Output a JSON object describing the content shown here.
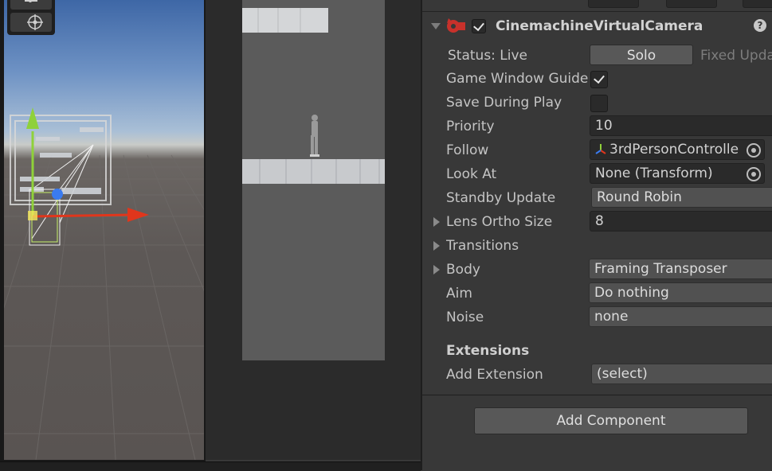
{
  "inspector": {
    "component": {
      "title": "CinemachineVirtualCamera",
      "enabled": true,
      "help_icon": "?"
    },
    "status": {
      "label": "Status: Live",
      "solo_button": "Solo",
      "update_text": "Fixed Upda"
    },
    "rows": {
      "game_window_guides": {
        "label": "Game Window Guide",
        "checked": true
      },
      "save_during_play": {
        "label": "Save During Play",
        "checked": false
      },
      "priority": {
        "label": "Priority",
        "value": "10"
      },
      "follow": {
        "label": "Follow",
        "value": "3rdPersonControlle"
      },
      "look_at": {
        "label": "Look At",
        "value": "None (Transform)"
      },
      "standby_update": {
        "label": "Standby Update",
        "value": "Round Robin"
      },
      "lens_ortho_size": {
        "label": "Lens Ortho Size",
        "value": "8"
      },
      "transitions": {
        "label": "Transitions"
      },
      "body": {
        "label": "Body",
        "value": "Framing Transposer"
      },
      "aim": {
        "label": "Aim",
        "value": "Do nothing"
      },
      "noise": {
        "label": "Noise",
        "value": "none"
      }
    },
    "extensions": {
      "heading": "Extensions",
      "add_label": "Add Extension",
      "add_value": "(select)"
    },
    "add_component_button": "Add Component"
  },
  "icons": {
    "component_icon": "cinemachine-camera-icon",
    "follow_target_icon": "transform-icon",
    "object_picker": "object-picker-icon"
  },
  "colors": {
    "panel_bg": "#383838",
    "field_bg": "#2a2a2a",
    "dropdown_bg": "#515151",
    "axis_x": "#e0361c",
    "axis_y": "#8fd13a",
    "axis_z": "#3a7bf0"
  }
}
